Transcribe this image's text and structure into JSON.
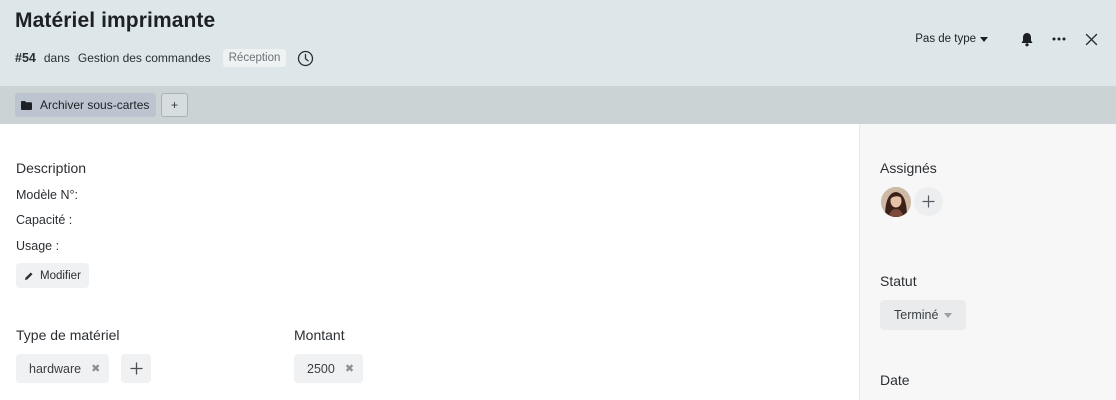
{
  "card": {
    "title": "Matériel imprimante",
    "number": "#54",
    "in_text": "dans",
    "board": "Gestion des commandes",
    "list": "Réception"
  },
  "header_actions": {
    "type_label": "Pas de type",
    "icons": [
      "bell-icon",
      "more-icon",
      "close-icon"
    ]
  },
  "toolbar": {
    "archive_label": "Archiver sous-cartes",
    "add_label": "+"
  },
  "description": {
    "heading": "Description",
    "lines": [
      "Modèle N°:",
      "Capacité :",
      "Usage :"
    ],
    "edit_label": "Modifier"
  },
  "fields": {
    "material_type": {
      "label": "Type de matériel",
      "value": "hardware",
      "remove": "✖"
    },
    "amount": {
      "label": "Montant",
      "value": "2500",
      "remove": "✖"
    }
  },
  "sidebar": {
    "assignees_label": "Assignés",
    "status_label": "Statut",
    "status_value": "Terminé",
    "date_label": "Date"
  },
  "colors": {
    "header_bg": "#dde6e8",
    "toolbar_bg": "#cbd3d5",
    "sidebar_bg": "#f7f7f7"
  }
}
